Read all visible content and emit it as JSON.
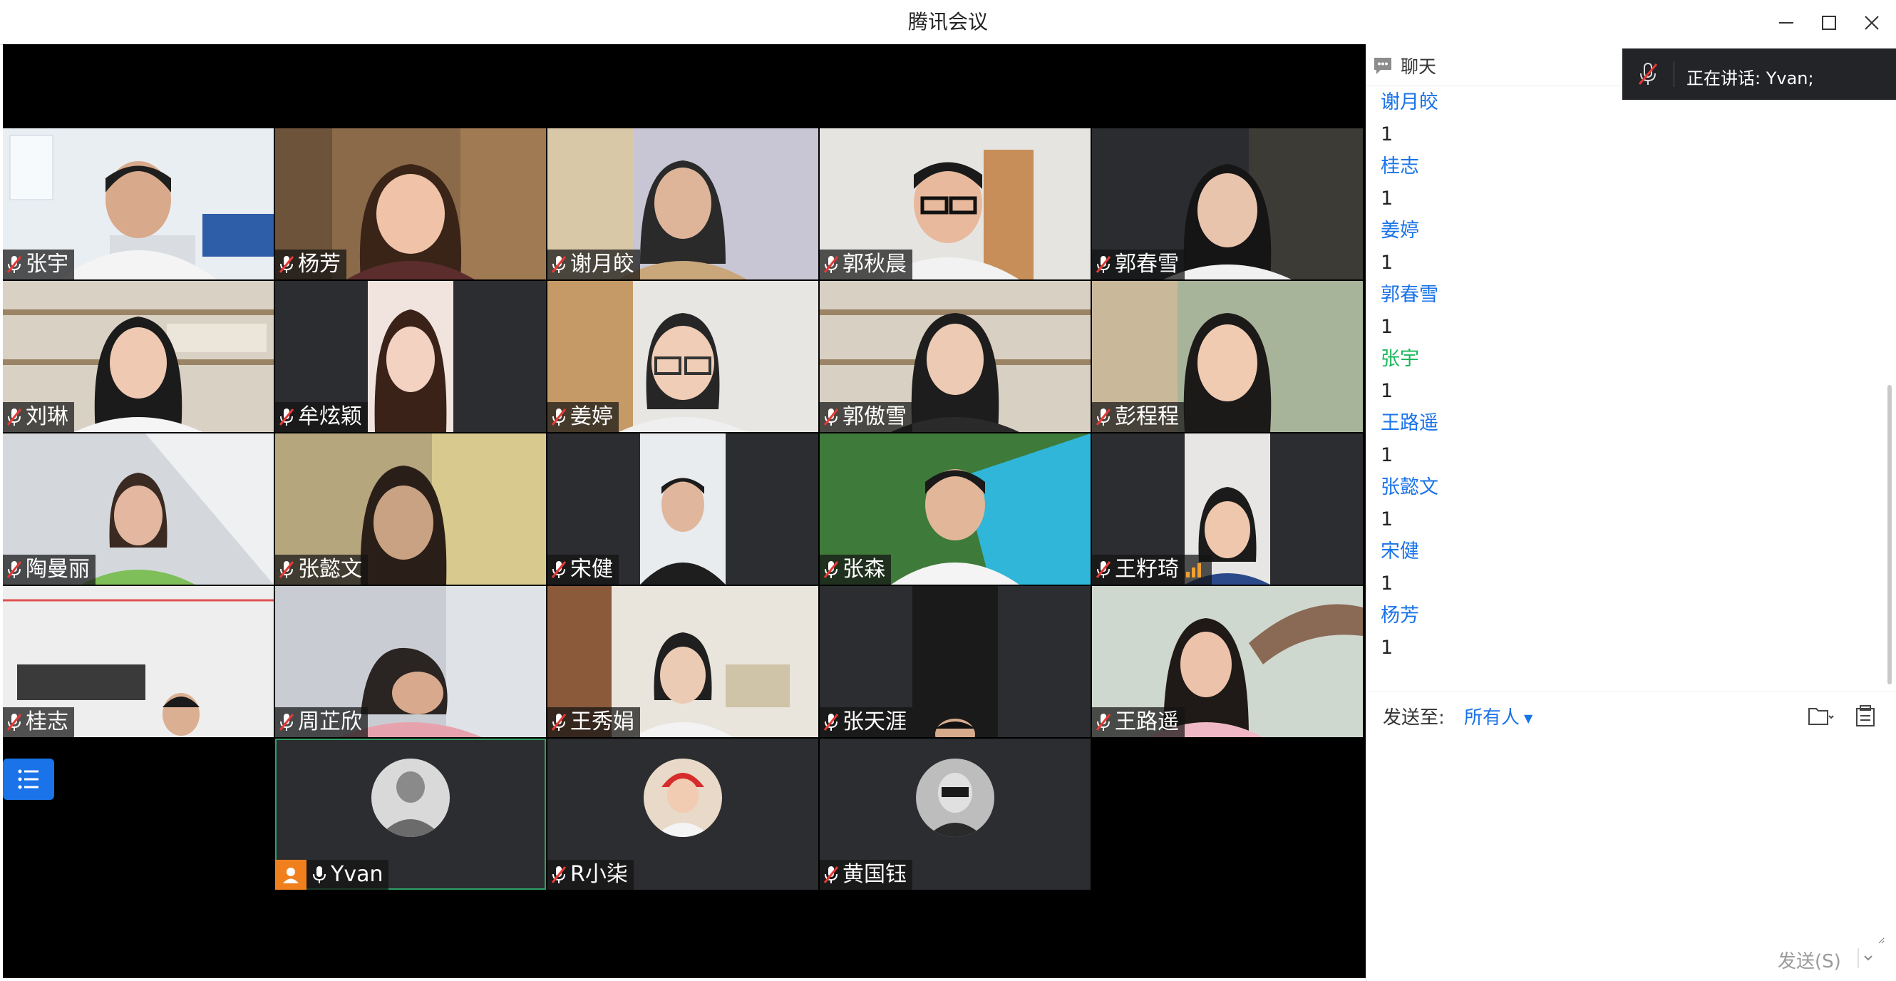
{
  "window": {
    "title": "腾讯会议"
  },
  "speaking": {
    "label": "正在讲话: Yvan;"
  },
  "participants": [
    {
      "name": "张宇"
    },
    {
      "name": "杨芳"
    },
    {
      "name": "谢月皎"
    },
    {
      "name": "郭秋晨"
    },
    {
      "name": "郭春雪"
    },
    {
      "name": "刘琳"
    },
    {
      "name": "牟炫颖"
    },
    {
      "name": "姜婷"
    },
    {
      "name": "郭傲雪"
    },
    {
      "name": "彭程程"
    },
    {
      "name": "陶曼丽"
    },
    {
      "name": "张懿文"
    },
    {
      "name": "宋健"
    },
    {
      "name": "张森"
    },
    {
      "name": "王籽琦"
    },
    {
      "name": "桂志"
    },
    {
      "name": "周芷欣"
    },
    {
      "name": "王秀娟"
    },
    {
      "name": "张天涯"
    },
    {
      "name": "王路遥"
    },
    {
      "name": "Yvan"
    },
    {
      "name": "R小柒"
    },
    {
      "name": "黄国钰"
    }
  ],
  "chat": {
    "header": "聊天",
    "messages": [
      {
        "name": "谢月皎",
        "text": "1"
      },
      {
        "name": "桂志",
        "text": "1"
      },
      {
        "name": "姜婷",
        "text": "1"
      },
      {
        "name": "郭春雪",
        "text": "1"
      },
      {
        "name": "张宇",
        "text": "1"
      },
      {
        "name": "王路遥",
        "text": "1"
      },
      {
        "name": "张懿文",
        "text": "1"
      },
      {
        "name": "宋健",
        "text": "1"
      },
      {
        "name": "杨芳",
        "text": "1"
      }
    ],
    "send_to_label": "发送至:",
    "recipient": "所有人",
    "send_button": "发送(S)"
  },
  "colors": {
    "accent": "#1a73e8",
    "self_name": "#1bb85a",
    "host_badge": "#f0801e",
    "active_border": "#2f9e63"
  }
}
